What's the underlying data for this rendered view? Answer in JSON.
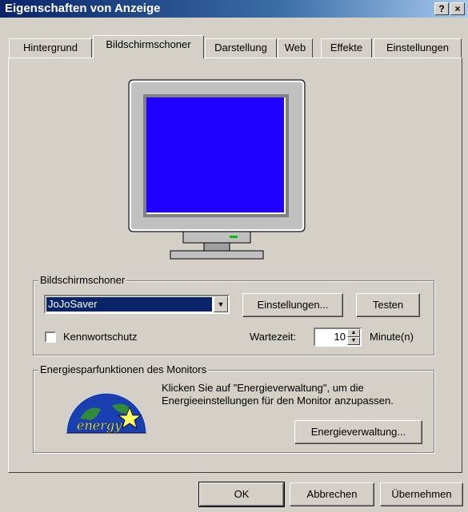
{
  "window": {
    "title": "Eigenschaften von Anzeige",
    "help_label": "?",
    "close_label": "×"
  },
  "tabs": [
    {
      "label": "Hintergrund"
    },
    {
      "label": "Bildschirmschoner"
    },
    {
      "label": "Darstellung"
    },
    {
      "label": "Web"
    },
    {
      "label": "Effekte"
    },
    {
      "label": "Einstellungen"
    }
  ],
  "preview": {
    "screen_color": "#2000ff"
  },
  "screensaver": {
    "group_label": "Bildschirmschoner",
    "selected": "JoJoSaver",
    "settings_button": "Einstellungen...",
    "test_button": "Testen",
    "password_label": "Kennwortschutz",
    "password_checked": false,
    "wait_label": "Wartezeit:",
    "wait_value": "10",
    "wait_unit": "Minute(n)"
  },
  "energy": {
    "group_label": "Energiesparfunktionen des Monitors",
    "description": "Klicken Sie auf \"Energieverwaltung\", um die Energieeinstellungen für den Monitor anzupassen.",
    "button": "Energieverwaltung...",
    "logo_text": "energy"
  },
  "footer": {
    "ok": "OK",
    "cancel": "Abbrechen",
    "apply": "Übernehmen"
  }
}
